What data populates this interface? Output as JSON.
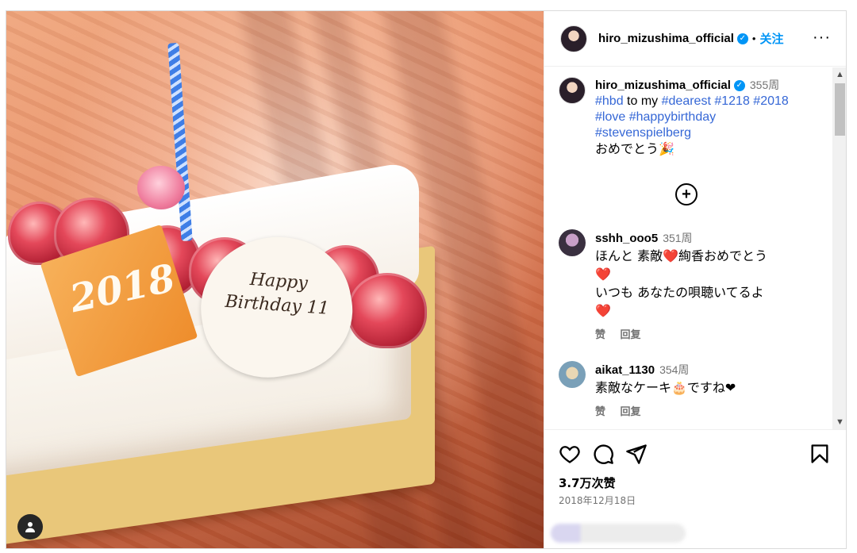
{
  "post": {
    "header": {
      "username": "hiro_mizushima_official",
      "verified_mark": "✓",
      "separator": "•",
      "follow_label": "关注",
      "more_label": "···"
    },
    "caption": {
      "username": "hiro_mizushima_official",
      "time": "355周",
      "hashtags_line1": [
        "#hbd"
      ],
      "text_to_my": "to my",
      "hashtags_rest": [
        "#dearest",
        "#1218",
        "#2018",
        "#love",
        "#happybirthday",
        "#stevenspielberg"
      ],
      "message": "おめでとう🎉"
    },
    "load_more_icon": "plus-circle-icon",
    "comments": [
      {
        "username": "sshh_ooo5",
        "time": "351周",
        "line1": "ほんと 素敵❤️絢香おめでとう",
        "line2": "❤️",
        "line3": "いつも あなたの唄聴いてるよ",
        "line4": "❤️",
        "like_label": "赞",
        "reply_label": "回复"
      },
      {
        "username": "aikat_1130",
        "time": "354周",
        "line1": "素敵なケーキ🎂ですね❤",
        "like_label": "赞",
        "reply_label": "回复"
      }
    ],
    "likes": "3.7万次赞",
    "date": "2018年12月18日",
    "photo": {
      "plate_year": "2018",
      "plate_message": "Happy Birthday 11"
    },
    "colors": {
      "link_blue": "#0095f6",
      "hashtag_blue": "#3567d6",
      "meta_gray": "#737373",
      "heart_red": "#e0245e"
    }
  }
}
